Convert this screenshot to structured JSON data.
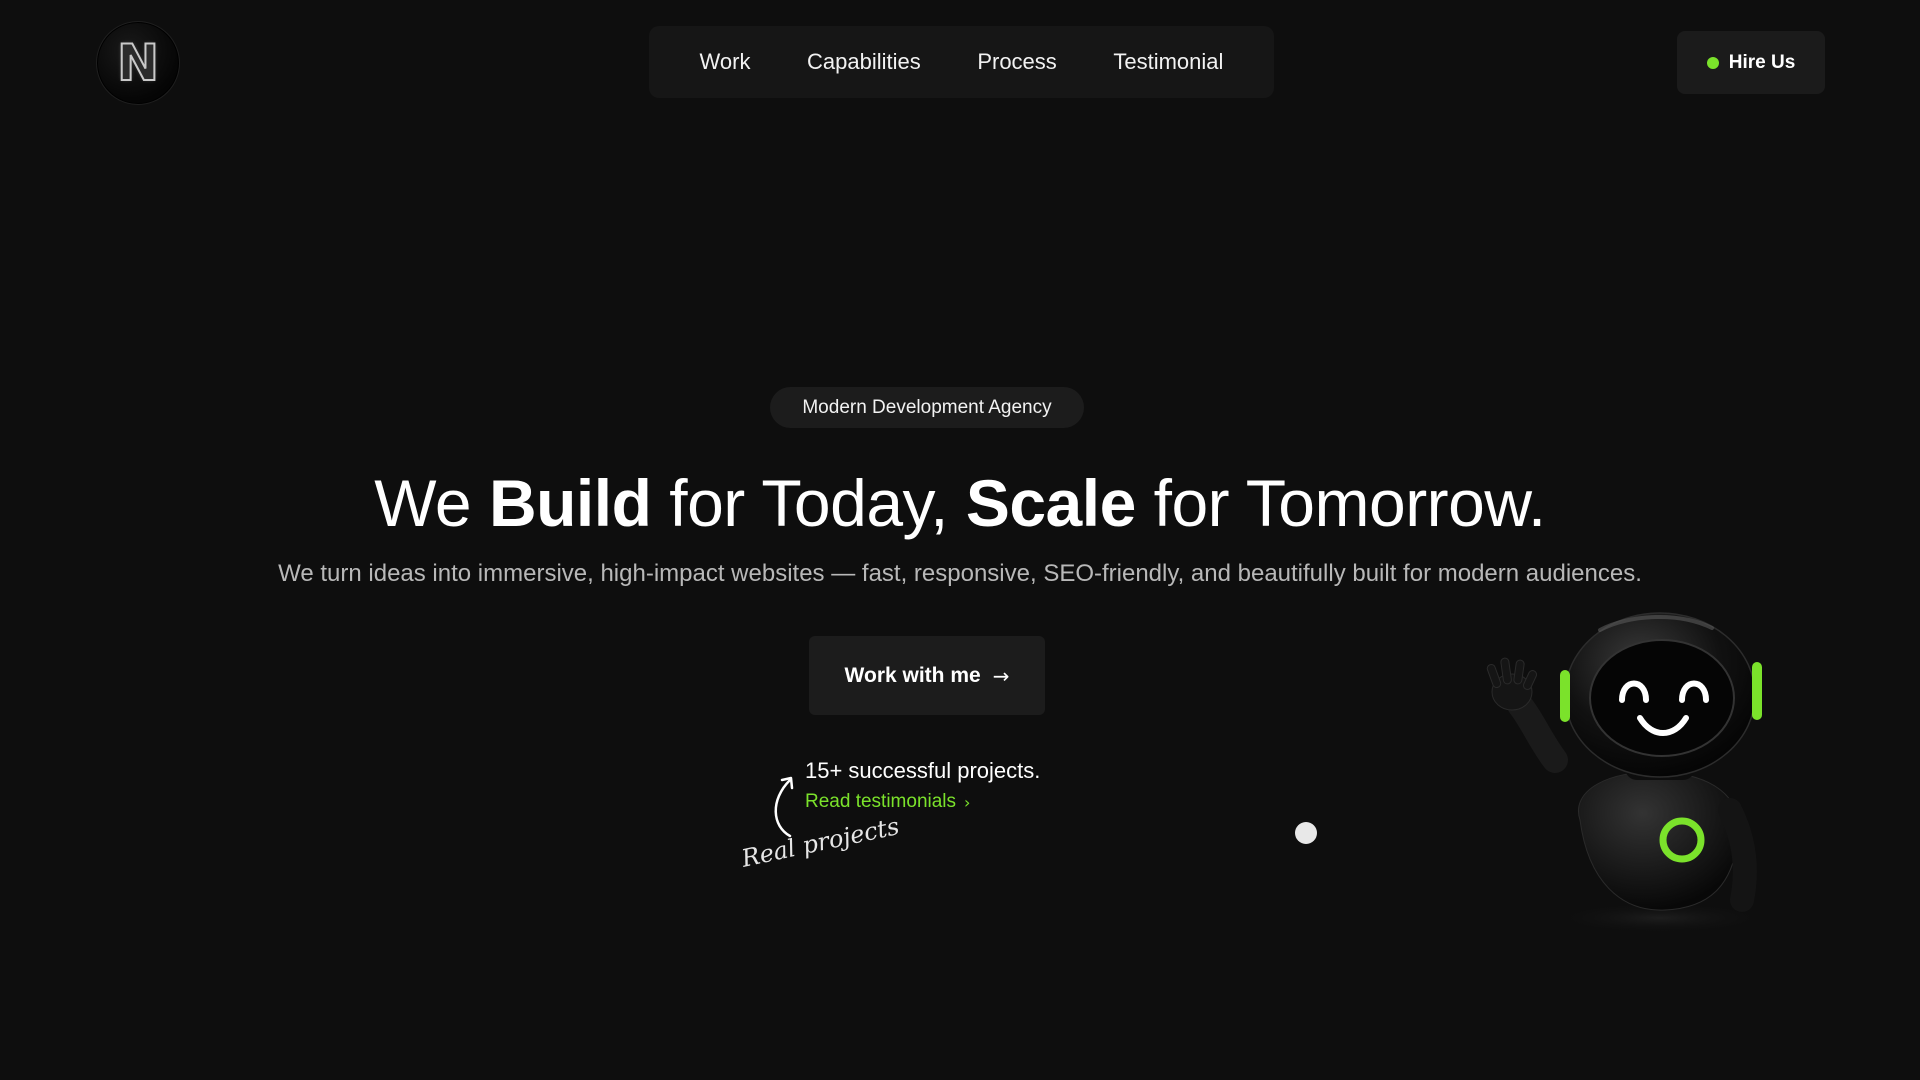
{
  "header": {
    "logo_letter": "N",
    "nav": [
      {
        "label": "Work"
      },
      {
        "label": "Capabilities"
      },
      {
        "label": "Process"
      },
      {
        "label": "Testimonial"
      }
    ],
    "hire_label": "Hire Us",
    "hire_status_color": "#7be22b"
  },
  "hero": {
    "badge": "Modern Development Agency",
    "headline": {
      "part1": "We ",
      "bold1": "Build",
      "part2": " for Today, ",
      "bold2": "Scale",
      "part3": " for Tomorrow."
    },
    "subheadline": "We turn ideas into immersive, high-impact websites — fast, responsive, SEO-friendly, and beautifully built for modern audiences.",
    "cta_label": "Work with me",
    "cta_icon": "arrow-right-icon",
    "proof": {
      "count_text": "15+ successful projects.",
      "link_label": "Read testimonials",
      "handwritten_note": "Real projects"
    }
  },
  "colors": {
    "background": "#0e0e0e",
    "accent": "#7be22b",
    "surface": "#1c1c1c"
  }
}
